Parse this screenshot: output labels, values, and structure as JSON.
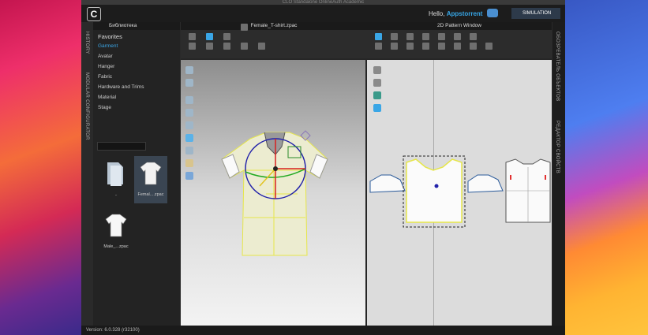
{
  "window_title": "CLO Standalone OnlineAuth Academic",
  "header": {
    "hello_prefix": "Hello, ",
    "username": "Appstorrent",
    "simulation_label": "SIMULATION"
  },
  "side_tabs": {
    "history": "HISTORY",
    "modular": "MODULAR CONFIGURATOR",
    "object_browser": "ОБОЗРЕВАТЕЛЬ ОБЪЕКТОВ",
    "property_editor": "РЕДАКТОР СВОЙСТВ"
  },
  "library": {
    "title": "Библиотека",
    "items": [
      "Favorites",
      "Garment",
      "Avatar",
      "Hanger",
      "Fabric",
      "Hardware and Trims",
      "Material",
      "Stage"
    ],
    "selected_index": 1,
    "files": [
      {
        "label": ".."
      },
      {
        "label": "Femal....zpac"
      },
      {
        "label": "Male_...zpac"
      }
    ]
  },
  "view3d": {
    "title": "Female_T-shirt.zpac"
  },
  "view2d": {
    "title": "2D Pattern Window"
  },
  "status": {
    "version": "Version: 6.0.328 (r32100)"
  }
}
